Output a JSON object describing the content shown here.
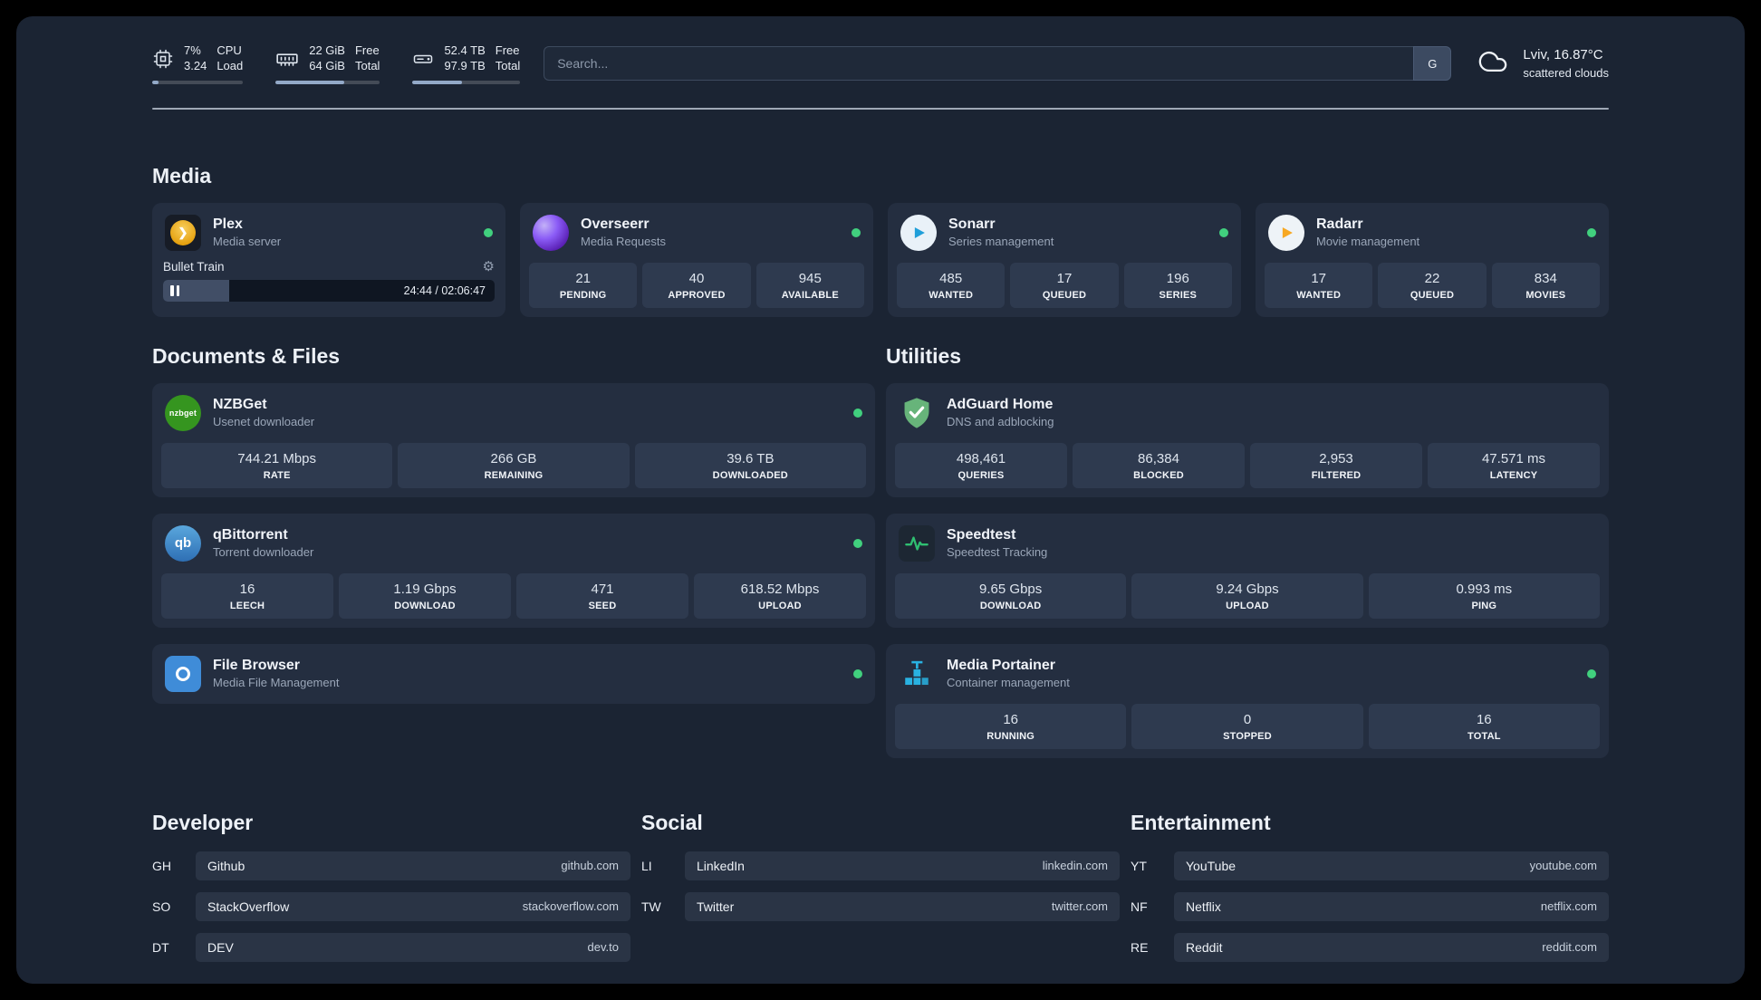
{
  "colors": {
    "status_online": "#41d07e"
  },
  "icons": {
    "gear": "⚙",
    "plex_chevron": "❯",
    "nzbget_label": "nzbget",
    "qbittorrent_label": "qb"
  },
  "header": {
    "cpu": {
      "value_top": "7%",
      "value_bottom": "3.24",
      "label_top": "CPU",
      "label_bottom": "Load",
      "bar_percent": 7
    },
    "memory": {
      "value_top": "22 GiB",
      "value_bottom": "64 GiB",
      "label_top": "Free",
      "label_bottom": "Total",
      "bar_percent": 66
    },
    "disk": {
      "value_top": "52.4 TB",
      "value_bottom": "97.9 TB",
      "label_top": "Free",
      "label_bottom": "Total",
      "bar_percent": 46
    },
    "search": {
      "placeholder": "Search...",
      "engine_label": "G"
    },
    "weather": {
      "location": "Lviv, 16.87°C",
      "condition": "scattered clouds"
    }
  },
  "sections": {
    "media": "Media",
    "documents": "Documents & Files",
    "utilities": "Utilities",
    "developer": "Developer",
    "social": "Social",
    "entertainment": "Entertainment"
  },
  "apps": {
    "plex": {
      "name": "Plex",
      "description": "Media server",
      "player": {
        "title": "Bullet Train",
        "time": "24:44 / 02:06:47",
        "progress_percent": 20
      }
    },
    "overseerr": {
      "name": "Overseerr",
      "description": "Media Requests",
      "stats": [
        {
          "value": "21",
          "label": "PENDING"
        },
        {
          "value": "40",
          "label": "APPROVED"
        },
        {
          "value": "945",
          "label": "AVAILABLE"
        }
      ]
    },
    "sonarr": {
      "name": "Sonarr",
      "description": "Series management",
      "stats": [
        {
          "value": "485",
          "label": "WANTED"
        },
        {
          "value": "17",
          "label": "QUEUED"
        },
        {
          "value": "196",
          "label": "SERIES"
        }
      ]
    },
    "radarr": {
      "name": "Radarr",
      "description": "Movie management",
      "stats": [
        {
          "value": "17",
          "label": "WANTED"
        },
        {
          "value": "22",
          "label": "QUEUED"
        },
        {
          "value": "834",
          "label": "MOVIES"
        }
      ]
    },
    "nzbget": {
      "name": "NZBGet",
      "description": "Usenet downloader",
      "stats": [
        {
          "value": "744.21 Mbps",
          "label": "RATE"
        },
        {
          "value": "266 GB",
          "label": "REMAINING"
        },
        {
          "value": "39.6 TB",
          "label": "DOWNLOADED"
        }
      ]
    },
    "qbittorrent": {
      "name": "qBittorrent",
      "description": "Torrent downloader",
      "stats": [
        {
          "value": "16",
          "label": "LEECH"
        },
        {
          "value": "1.19 Gbps",
          "label": "DOWNLOAD"
        },
        {
          "value": "471",
          "label": "SEED"
        },
        {
          "value": "618.52 Mbps",
          "label": "UPLOAD"
        }
      ]
    },
    "filebrowser": {
      "name": "File Browser",
      "description": "Media File Management"
    },
    "adguard": {
      "name": "AdGuard Home",
      "description": "DNS and adblocking",
      "stats": [
        {
          "value": "498,461",
          "label": "QUERIES"
        },
        {
          "value": "86,384",
          "label": "BLOCKED"
        },
        {
          "value": "2,953",
          "label": "FILTERED"
        },
        {
          "value": "47.571 ms",
          "label": "LATENCY"
        }
      ]
    },
    "speedtest": {
      "name": "Speedtest",
      "description": "Speedtest Tracking",
      "stats": [
        {
          "value": "9.65 Gbps",
          "label": "DOWNLOAD"
        },
        {
          "value": "9.24 Gbps",
          "label": "UPLOAD"
        },
        {
          "value": "0.993 ms",
          "label": "PING"
        }
      ]
    },
    "portainer": {
      "name": "Media Portainer",
      "description": "Container management",
      "stats": [
        {
          "value": "16",
          "label": "RUNNING"
        },
        {
          "value": "0",
          "label": "STOPPED"
        },
        {
          "value": "16",
          "label": "TOTAL"
        }
      ]
    }
  },
  "bookmarks": {
    "developer": [
      {
        "abbr": "GH",
        "name": "Github",
        "url": "github.com"
      },
      {
        "abbr": "SO",
        "name": "StackOverflow",
        "url": "stackoverflow.com"
      },
      {
        "abbr": "DT",
        "name": "DEV",
        "url": "dev.to"
      }
    ],
    "social": [
      {
        "abbr": "LI",
        "name": "LinkedIn",
        "url": "linkedin.com"
      },
      {
        "abbr": "TW",
        "name": "Twitter",
        "url": "twitter.com"
      }
    ],
    "entertainment": [
      {
        "abbr": "YT",
        "name": "YouTube",
        "url": "youtube.com"
      },
      {
        "abbr": "NF",
        "name": "Netflix",
        "url": "netflix.com"
      },
      {
        "abbr": "RE",
        "name": "Reddit",
        "url": "reddit.com"
      }
    ]
  }
}
